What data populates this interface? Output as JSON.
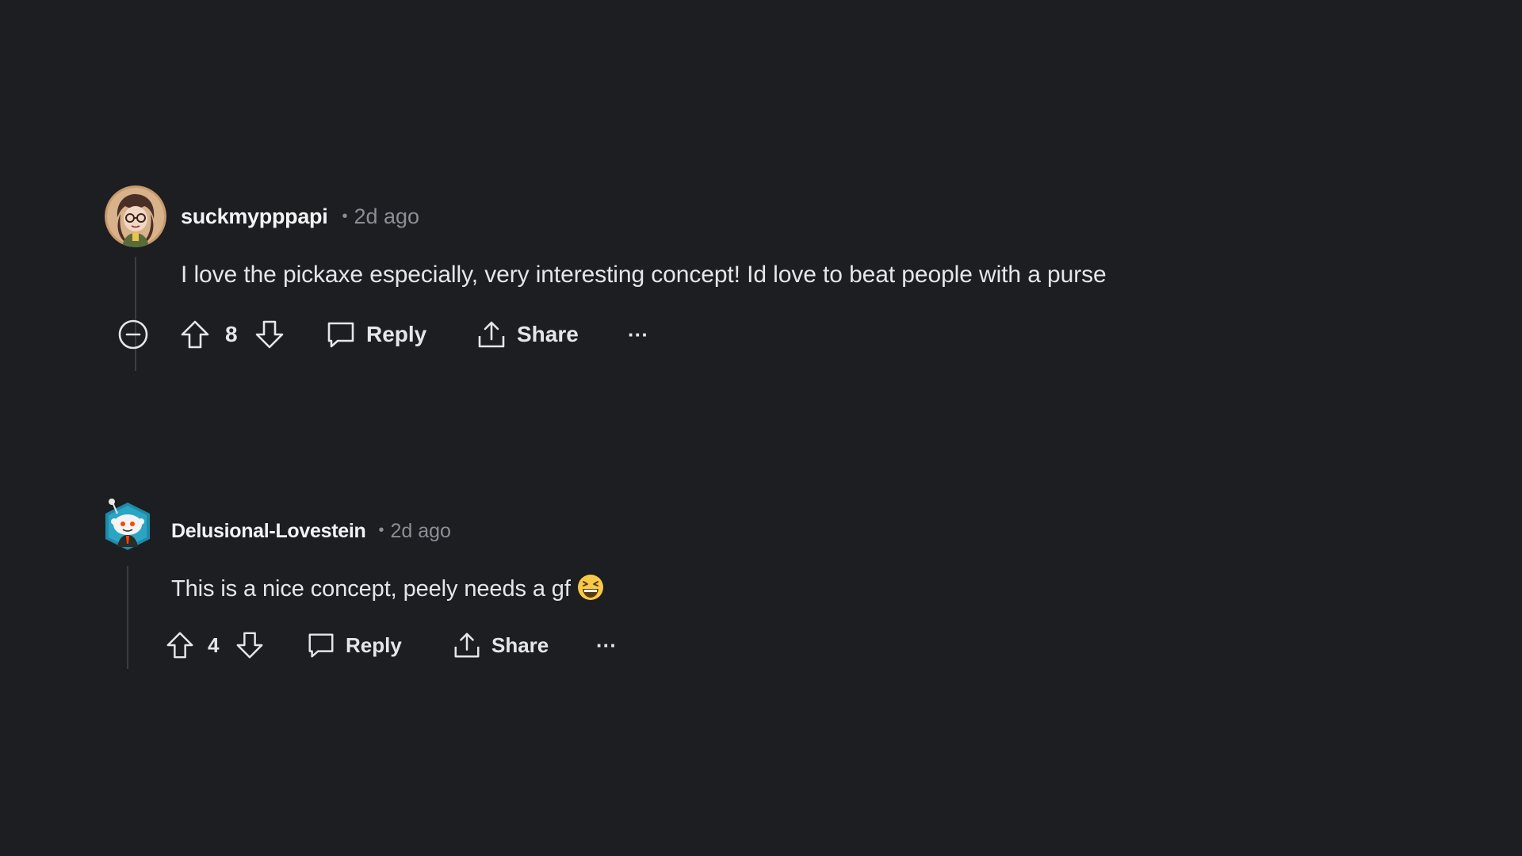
{
  "comments": [
    {
      "username": "suckmypppapi",
      "separator": "•",
      "time": "2d ago",
      "body": "I love the pickaxe especially, very interesting concept! Id love to beat people with a purse",
      "votes": "8",
      "reply_label": "Reply",
      "share_label": "Share",
      "more_label": "···",
      "avatar_color": "#c99a6a"
    },
    {
      "username": "Delusional-Lovestein",
      "separator": "•",
      "time": "2d ago",
      "body": "This is a nice concept, peely needs a gf",
      "emoji": "grinning-squinting-face",
      "votes": "4",
      "reply_label": "Reply",
      "share_label": "Share",
      "more_label": "···",
      "avatar_color": "#1f8aa8"
    }
  ],
  "colors": {
    "background": "#1c1e21",
    "text": "#e4e6e9",
    "muted": "#8b8f94"
  }
}
